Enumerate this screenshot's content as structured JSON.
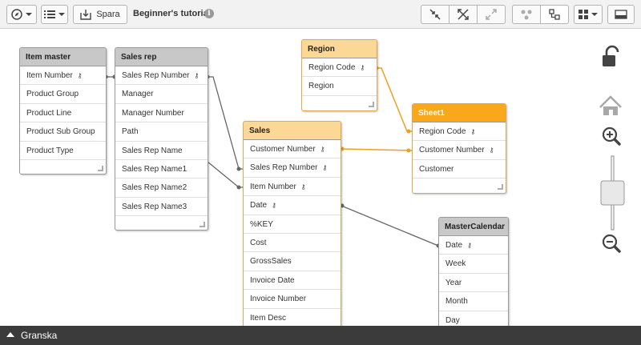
{
  "toolbar": {
    "save_label": "Spara",
    "app_title": "Beginner's tutorial"
  },
  "tables": [
    {
      "name": "Item master",
      "fields": [
        {
          "label": "Item Number",
          "key": true
        },
        {
          "label": "Product Group"
        },
        {
          "label": "Product Line"
        },
        {
          "label": "Product Sub Group"
        },
        {
          "label": "Product Type"
        }
      ]
    },
    {
      "name": "Sales rep",
      "fields": [
        {
          "label": "Sales Rep Number",
          "key": true
        },
        {
          "label": "Manager"
        },
        {
          "label": "Manager Number"
        },
        {
          "label": "Path"
        },
        {
          "label": "Sales Rep Name"
        },
        {
          "label": "Sales Rep Name1"
        },
        {
          "label": "Sales Rep Name2"
        },
        {
          "label": "Sales Rep Name3"
        }
      ]
    },
    {
      "name": "Region",
      "fields": [
        {
          "label": "Region Code",
          "key": true
        },
        {
          "label": "Region"
        }
      ]
    },
    {
      "name": "Sales",
      "fields": [
        {
          "label": "Customer Number",
          "key": true
        },
        {
          "label": "Sales Rep Number",
          "key": true
        },
        {
          "label": "Item Number",
          "key": true
        },
        {
          "label": "Date",
          "key": true
        },
        {
          "label": "%KEY"
        },
        {
          "label": "Cost"
        },
        {
          "label": "GrossSales"
        },
        {
          "label": "Invoice Date"
        },
        {
          "label": "Invoice Number"
        },
        {
          "label": "Item Desc"
        }
      ]
    },
    {
      "name": "Sheet1",
      "fields": [
        {
          "label": "Region Code",
          "key": true
        },
        {
          "label": "Customer Number",
          "key": true
        },
        {
          "label": "Customer"
        }
      ]
    },
    {
      "name": "MasterCalendar",
      "fields": [
        {
          "label": "Date",
          "key": true
        },
        {
          "label": "Week"
        },
        {
          "label": "Year"
        },
        {
          "label": "Month"
        },
        {
          "label": "Day"
        }
      ]
    }
  ],
  "icons": {
    "key": "key-icon"
  },
  "colors": {
    "highlight_link": "#f0a020",
    "normal_link": "#555555",
    "header_default": "#c8c8c8",
    "header_light_orange": "#fcd896",
    "header_orange": "#f8a81a"
  },
  "statusbar": {
    "label": "Granska"
  }
}
